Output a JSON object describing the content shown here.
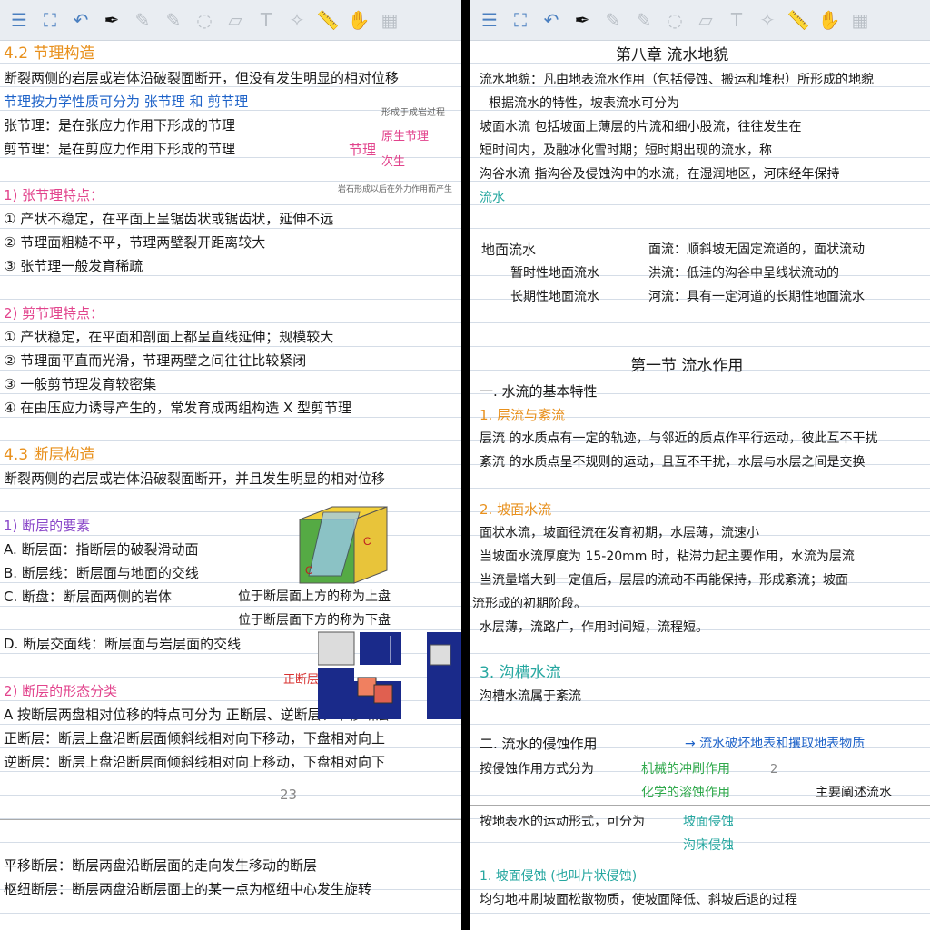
{
  "toolbar": {
    "icons": [
      "menu-icon",
      "photo-edit-icon",
      "undo-icon",
      "pen-icon",
      "pencil-icon",
      "pencil-2-icon",
      "lasso-icon",
      "eraser-icon",
      "text-icon",
      "shape-icon",
      "ruler-icon",
      "hand-icon",
      "grid-icon"
    ]
  },
  "left": {
    "lines": [
      "4.2 节理构造",
      "断裂两侧的岩层或岩体沿破裂面断开，但没有发生明显的相对位移",
      "节理按力学性质可分为 张节理 和 剪节理",
      "张节理：是在张应力作用下形成的节理",
      "剪节理：是在剪应力作用下形成的节理",
      "1) 张节理特点：",
      "① 产状不稳定，在平面上呈锯齿状或锯齿状，延伸不远",
      "② 节理面粗糙不平，节理两壁裂开距离较大",
      "③ 张节理一般发育稀疏",
      "2) 剪节理特点：",
      "① 产状稳定，在平面和剖面上都呈直线延伸；规模较大",
      "② 节理面平直而光滑，节理两壁之间往往比较紧闭",
      "③ 一般剪节理发育较密集",
      "④ 在由压应力诱导产生的，常发育成两组构造 X 型剪节理",
      "4.3 断层构造",
      "断裂两侧的岩层或岩体沿破裂面断开，并且发生明显的相对位移",
      "1) 断层的要素",
      "A. 断层面：指断层的破裂滑动面",
      "B. 断层线：断层面与地面的交线",
      "C. 断盘：断层面两侧的岩体",
      "位于断层面上方的称为上盘",
      "位于断层面下方的称为下盘",
      "D. 断层交面线：断层面与岩层面的交线",
      "2) 断层的形态分类",
      "A 按断层两盘相对位移的特点可分为 正断层、逆断层、平移断层",
      "正断层：断层上盘沿断层面倾斜线相对向下移动，下盘相对向上",
      "逆断层：断层上盘沿断层面倾斜线相对向上移动，下盘相对向下",
      "平移断层：断层两盘沿断层面的走向发生移动的断层",
      "枢纽断层：断层两盘沿断层面上的某一点为枢纽中心发生旋转"
    ],
    "margin_notes": [
      "形成于成岩过程",
      "原生节理",
      "次生",
      "节理",
      "岩石形成以后在外力作用而产生"
    ],
    "figure_note": "正断层",
    "page_number": "23"
  },
  "right": {
    "lines": [
      "第八章  流水地貌",
      "流水地貌：凡由地表流水作用（包括侵蚀、搬运和堆积）所形成的地貌",
      "根据流水的特性，坡表流水可分为",
      "坡面水流 包括坡面上薄层的片流和细小股流，往往发生在",
      "短时间内，及融冰化雪时期；短时期出现的流水，称",
      "沟谷水流 指沟谷及侵蚀沟中的水流，在湿润地区，河床经年保持",
      "流水",
      "地面流水",
      "暂时性地面流水",
      "长期性地面流水",
      "面流：顺斜坡无固定流道的，面状流动",
      "洪流：低洼的沟谷中呈线状流动的",
      "河流：具有一定河道的长期性地面流水",
      "第一节  流水作用",
      "一. 水流的基本特性",
      "1. 层流与紊流",
      "层流 的水质点有一定的轨迹，与邻近的质点作平行运动，彼此互不干扰",
      "紊流 的水质点呈不规则的运动，且互不干扰，水层与水层之间是交换",
      "2. 坡面水流",
      "面状水流，坡面径流在发育初期，水层薄，流速小",
      "当坡面水流厚度为 15-20mm 时，粘滞力起主要作用，水流为层流",
      "当流量增大到一定值后，层层的流动不再能保持，形成紊流；坡面",
      "流形成的初期阶段。",
      "水层薄，流路广，作用时间短，流程短。",
      "3. 沟槽水流",
      "沟槽水流属于紊流",
      "二. 流水的侵蚀作用",
      "→ 流水破坏地表和攫取地表物质",
      "按侵蚀作用方式分为",
      "机械的冲刷作用",
      "化学的溶蚀作用",
      "主要阐述流水",
      "按地表水的运动形式，可分为",
      "坡面侵蚀",
      "沟床侵蚀",
      "1. 坡面侵蚀  (也叫片状侵蚀)",
      "均匀地冲刷坡面松散物质，使坡面降低、斜坡后退的过程"
    ],
    "page_number": "2"
  }
}
